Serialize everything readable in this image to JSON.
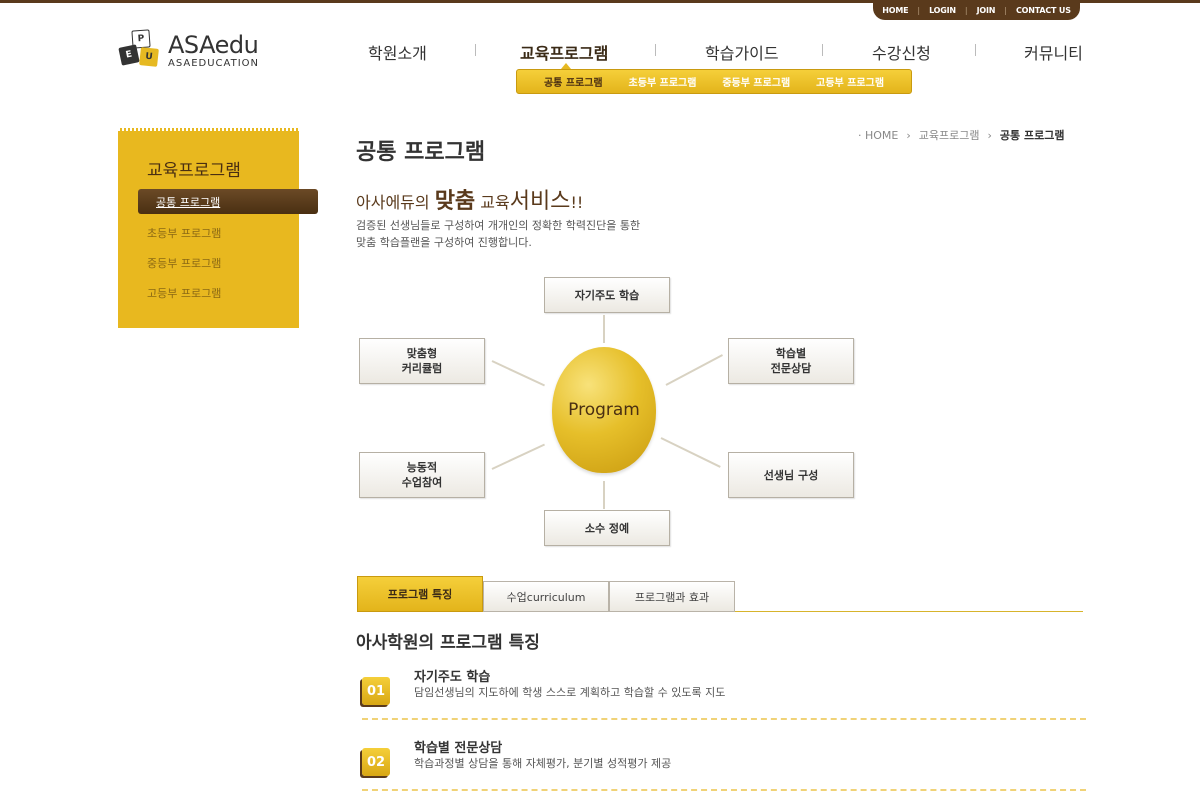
{
  "util_nav": [
    "HOME",
    "LOGIN",
    "JOIN",
    "CONTACT US"
  ],
  "logo": {
    "cubes": [
      "P",
      "E",
      "U"
    ],
    "name": "ASAedu",
    "sub": "ASAEDUCATION"
  },
  "gnb": {
    "items": [
      "학원소개",
      "교육프로그램",
      "학습가이드",
      "수강신청",
      "커뮤니티"
    ],
    "active_index": 1
  },
  "subnav": [
    "공통 프로그램",
    "초등부 프로그램",
    "중등부 프로그램",
    "고등부 프로그램"
  ],
  "lnb": {
    "title": "교육프로그램",
    "items": [
      "공통 프로그램",
      "초등부 프로그램",
      "중등부 프로그램",
      "고등부 프로그램"
    ]
  },
  "page_title": "공통 프로그램",
  "breadcrumb": [
    "HOME",
    "교육프로그램",
    "공통 프로그램"
  ],
  "headline": {
    "part1": "아사에듀의 ",
    "part2": "맞춤",
    "part3": " 교육",
    "part4": "서비스",
    "part5": "!!"
  },
  "intro": [
    "검증된 선생님들로 구성하여 개개인의 정확한 학력진단을 통한",
    "맞춤 학습플랜을 구성하여 진행합니다."
  ],
  "diagram": {
    "center": "Program",
    "top": "자기주도 학습",
    "left_upper": [
      "맞춤형",
      "커리큘럼"
    ],
    "right_upper": [
      "학습별",
      "전문상담"
    ],
    "left_lower": [
      "능동적",
      "수업참여"
    ],
    "right_lower": "선생님 구성",
    "bottom": "소수 정예"
  },
  "tabs": [
    "프로그램 특징",
    "수업curriculum",
    "프로그램과 효과"
  ],
  "section_title": "아사학원의 프로그램 특징",
  "features": [
    {
      "num": "01",
      "title": "자기주도 학습",
      "desc": "담임선생님의 지도하에 학생 스스로 계획하고 학습할 수 있도록 지도"
    },
    {
      "num": "02",
      "title": "학습별 전문상담",
      "desc": "학습과정별 상담을 통해 자체평가, 분기별 성적평가 제공"
    }
  ],
  "colors": {
    "brown": "#5a3a1c",
    "gold": "#e8b81f"
  }
}
